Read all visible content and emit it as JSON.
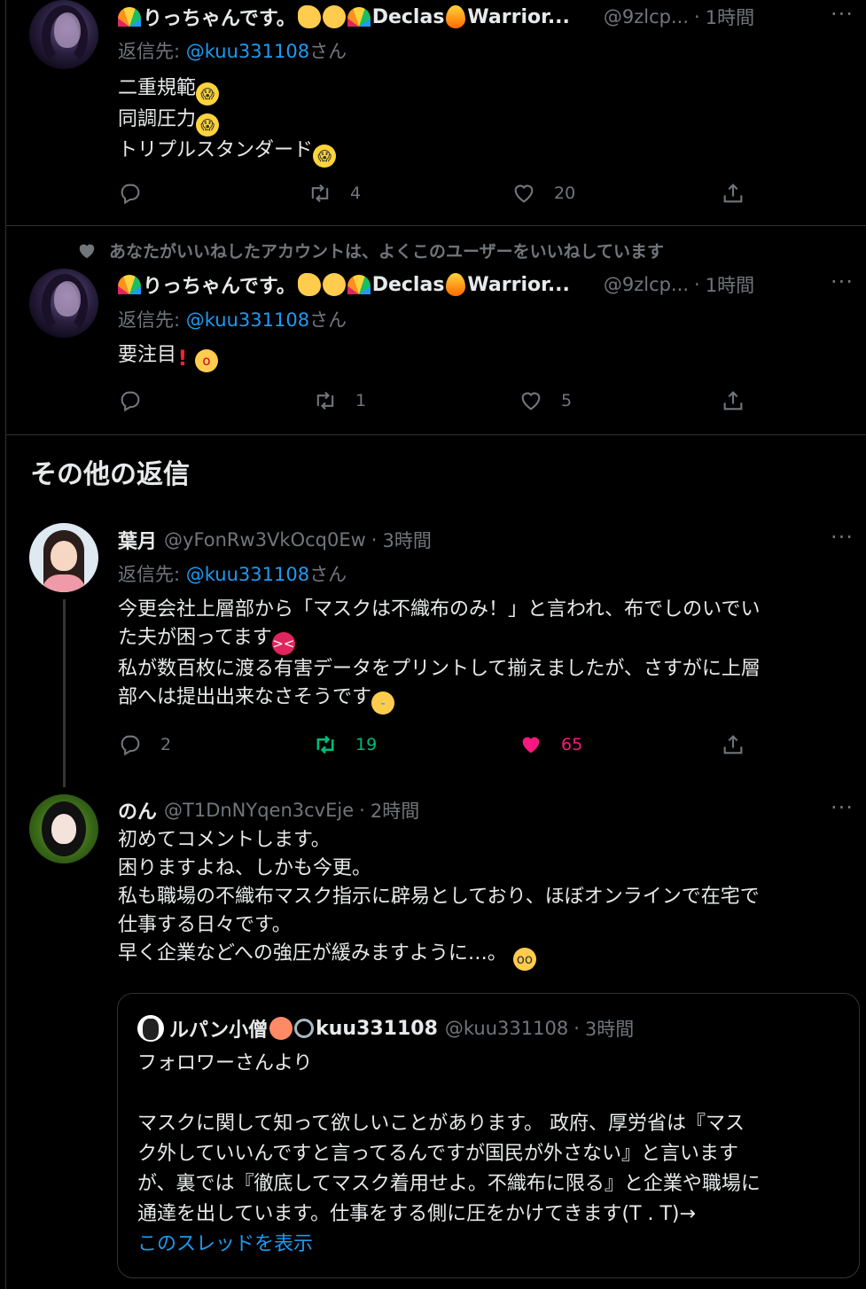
{
  "colors": {
    "accent": "#1d9bf0",
    "retweet_active": "#00ba7c",
    "like_active": "#f91880",
    "muted": "#71767b",
    "background": "#000000"
  },
  "tweets": [
    {
      "name": "りっちゃんです。",
      "name_tail_1": "Declas",
      "name_tail_2": "Warrior...",
      "handle": "@9zlcp...",
      "time": "1時間",
      "reply_prefix": "返信先: ",
      "reply_mention": "@kuu331108",
      "reply_suffix": "さん",
      "lines": [
        "二重規範",
        "同調圧力",
        "トリプルスタンダード"
      ],
      "reply_count": "",
      "retweet_count": "4",
      "like_count": "20"
    },
    {
      "social_context": "あなたがいいねしたアカウントは、よくこのユーザーをいいねしています",
      "name": "りっちゃんです。",
      "name_tail_1": "Declas",
      "name_tail_2": "Warrior...",
      "handle": "@9zlcp...",
      "time": "1時間",
      "reply_prefix": "返信先: ",
      "reply_mention": "@kuu331108",
      "reply_suffix": "さん",
      "lines": [
        "要注目"
      ],
      "reply_count": "",
      "retweet_count": "1",
      "like_count": "5"
    },
    {
      "name": "葉月",
      "handle": "@yFonRw3VkOcq0Ew",
      "time": "3時間",
      "reply_prefix": "返信先: ",
      "reply_mention": "@kuu331108",
      "reply_suffix": "さん",
      "lines": [
        "今更会社上層部から「マスクは不織布のみ！」と言われ、布でしのいでい",
        "た夫が困ってます",
        "私が数百枚に渡る有害データをプリントして揃えましたが、さすがに上層",
        "部へは提出出来なさそうです"
      ],
      "reply_count": "2",
      "retweet_count": "19",
      "like_count": "65"
    },
    {
      "name": "のん",
      "handle": "@T1DnNYqen3cvEje",
      "time": "2時間",
      "lines": [
        "初めてコメントします。",
        "困りますよね、しかも今更。",
        "私も職場の不織布マスク指示に辟易としており、ほぼオンラインで在宅で",
        "仕事する日々です。",
        "早く企業などへの強圧が緩みますように…。"
      ]
    }
  ],
  "section_title": "その他の返信",
  "quote": {
    "name": "ルパン小僧",
    "name_tail": "kuu331108",
    "handle": "@kuu331108",
    "time": "3時間",
    "lines": [
      "フォロワーさんより",
      "",
      "マスクに関して知って欲しいことがあります。 政府、厚労省は『マス",
      "ク外していいんですと言ってるんですが国民が外さない』と言います",
      "が、裏では『徹底してマスク着用せよ。不織布に限る』と企業や職場に",
      "通達を出しています。仕事をする側に圧をかけてきます(T . T)→"
    ],
    "show_thread": "このスレッドを表示"
  },
  "icons": [
    "reply-icon",
    "retweet-icon",
    "like-icon",
    "share-icon",
    "more-icon",
    "heart-context-icon"
  ]
}
